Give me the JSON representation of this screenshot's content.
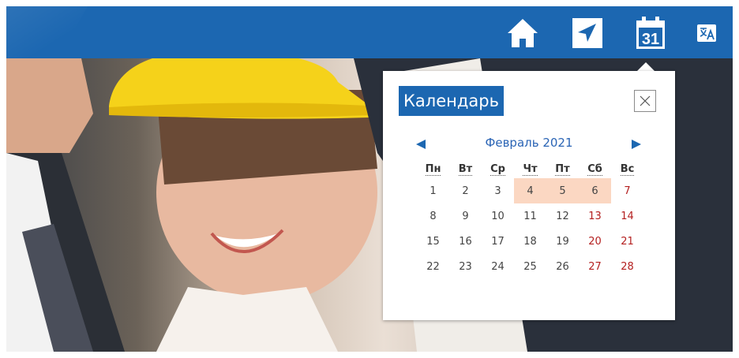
{
  "topbar": {
    "bg_color": "#1c67b1",
    "icons": {
      "home": "home-icon",
      "send": "send-icon",
      "calendar": "calendar-icon",
      "translate": "translate-icon"
    },
    "calendar_icon_number": "31"
  },
  "calendar": {
    "title": "Календарь",
    "close_icon": "close-icon",
    "month_year": "Февраль 2021",
    "prev": "◄",
    "next": "►",
    "weekdays": [
      "Пн",
      "Вт",
      "Ср",
      "Чт",
      "Пт",
      "Сб",
      "Вс"
    ],
    "weeks": [
      [
        "1",
        "2",
        "3",
        "4",
        "5",
        "6",
        "7"
      ],
      [
        "8",
        "9",
        "10",
        "11",
        "12",
        "13",
        "14"
      ],
      [
        "15",
        "16",
        "17",
        "18",
        "19",
        "20",
        "21"
      ],
      [
        "22",
        "23",
        "24",
        "25",
        "26",
        "27",
        "28"
      ]
    ],
    "highlighted_days": [
      "4",
      "5",
      "6"
    ],
    "highlight_color": "#fbd7c2",
    "weekend_color": "#b42020",
    "accent_color": "#2a64b5"
  }
}
